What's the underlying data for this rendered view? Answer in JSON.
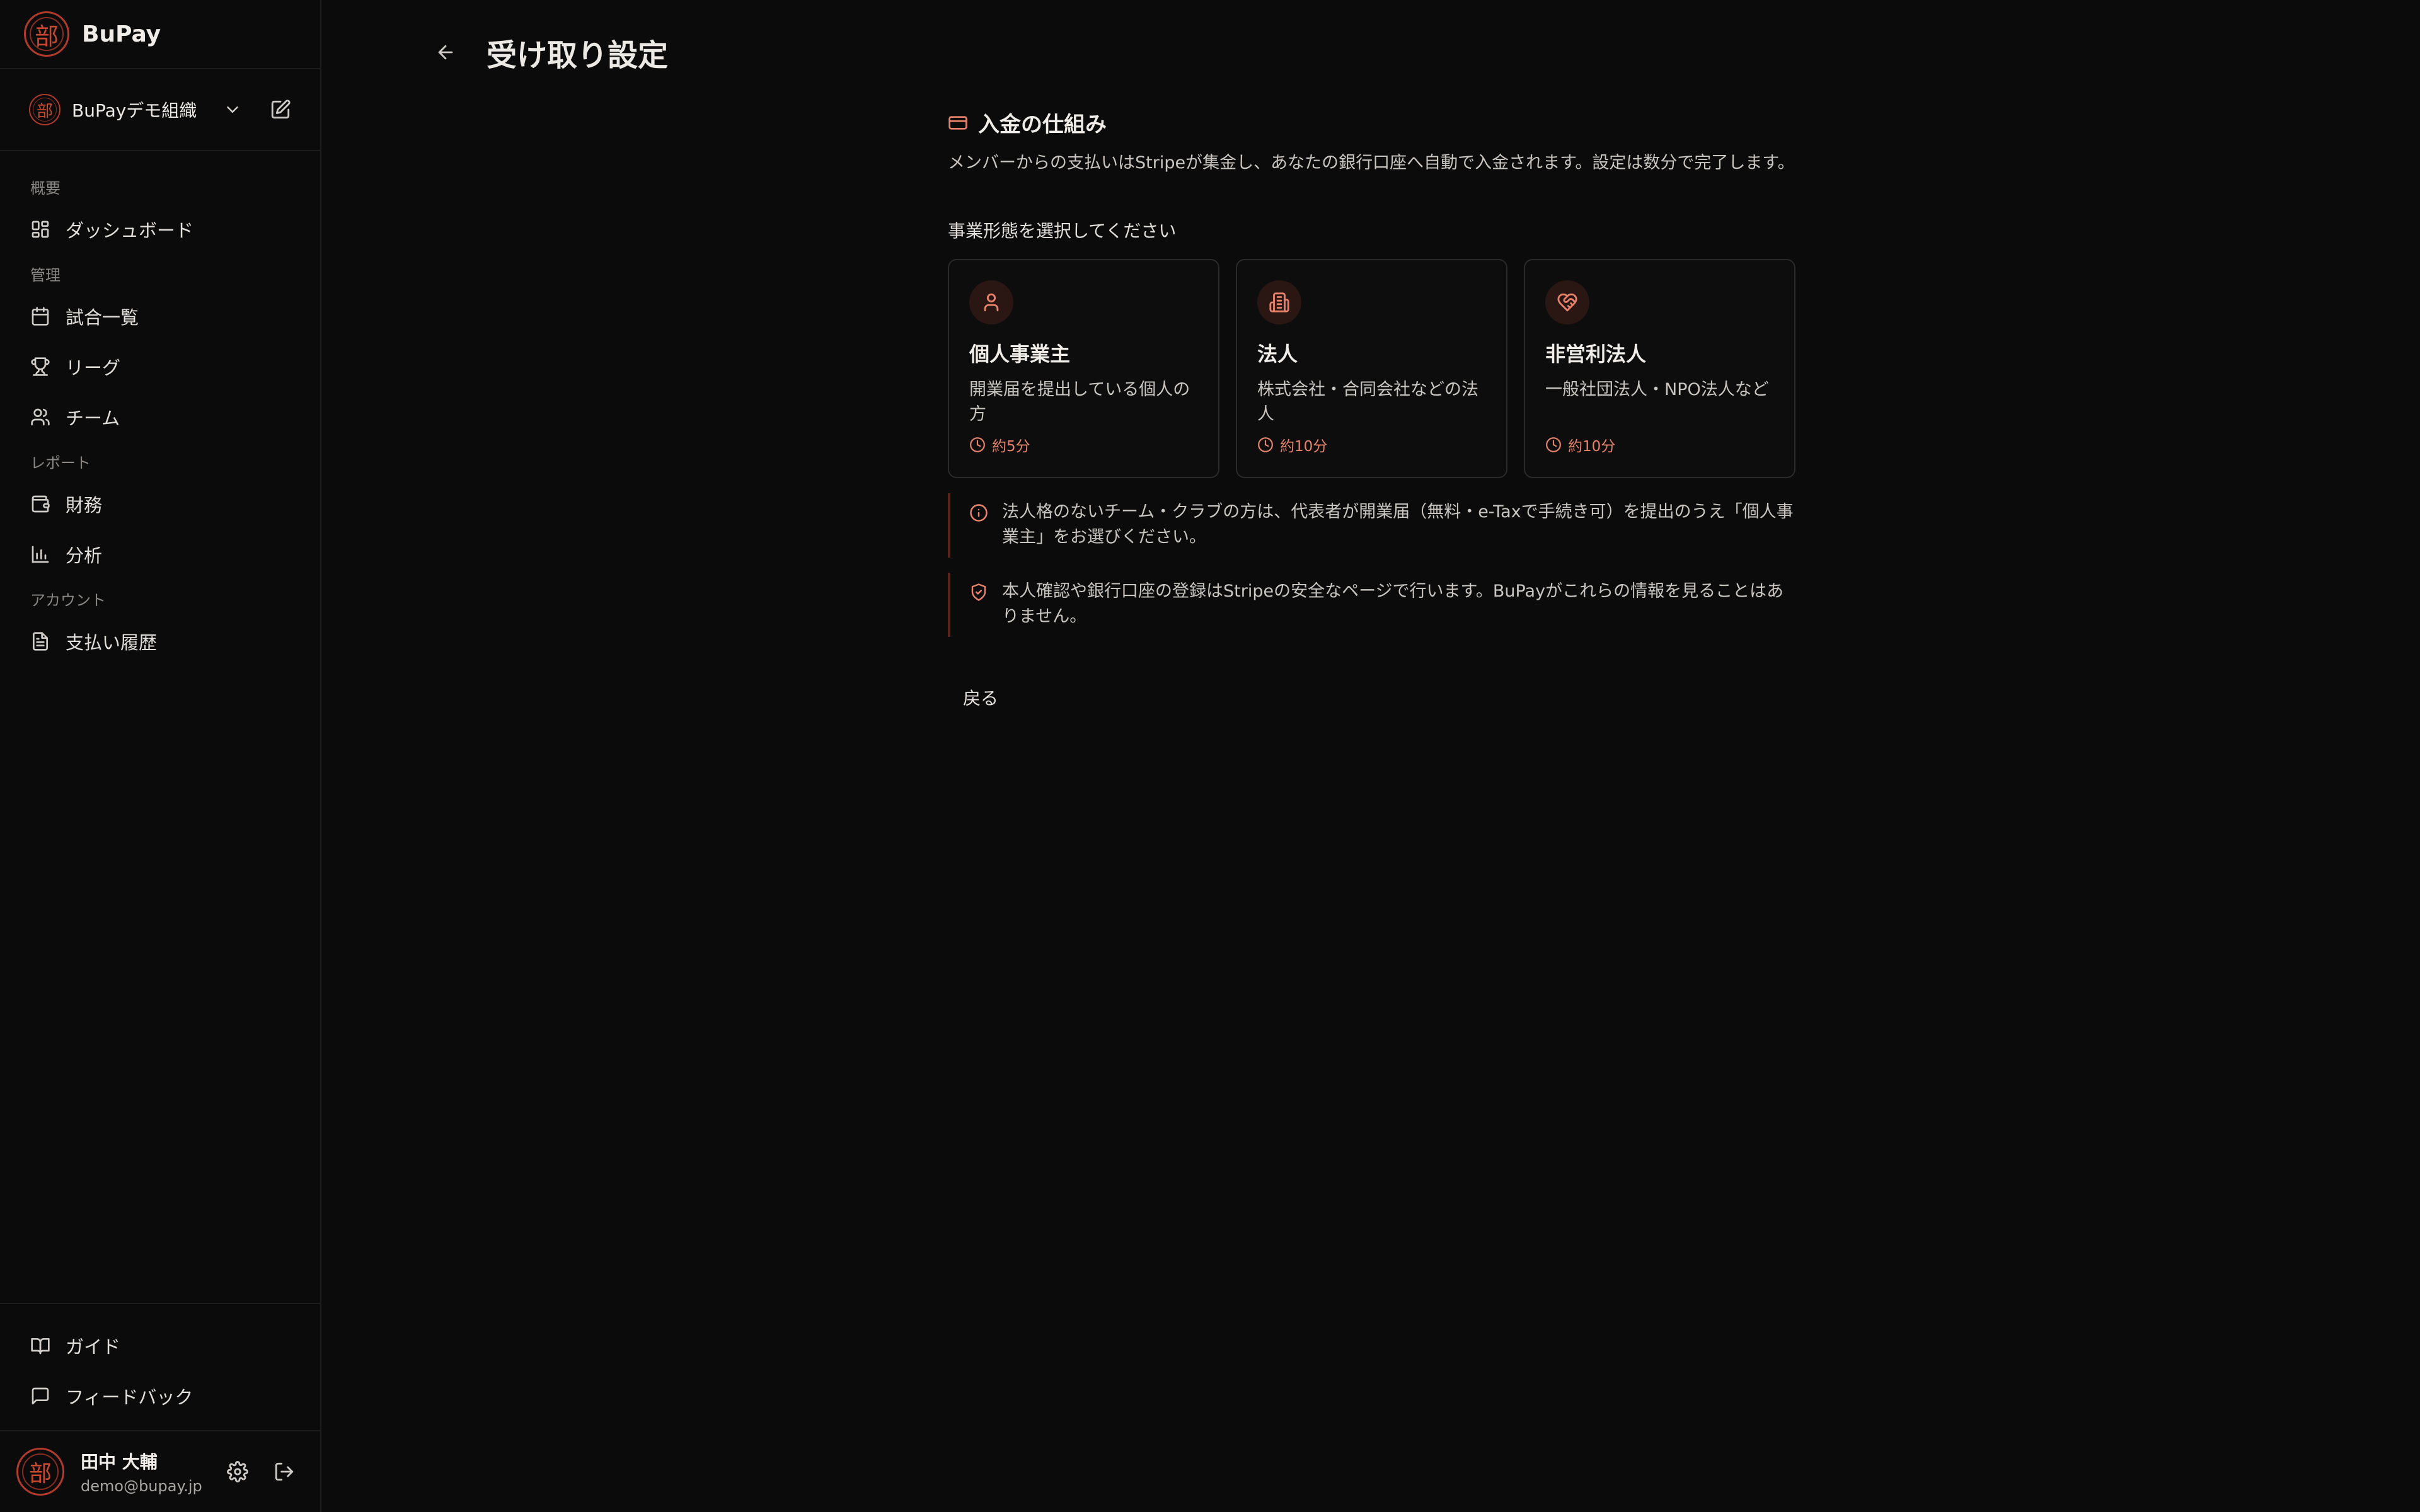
{
  "brand": {
    "logo_char": "部",
    "name": "BuPay"
  },
  "org": {
    "logo_char": "部",
    "name": "BuPayデモ組織"
  },
  "nav": [
    {
      "group": "概要",
      "items": [
        {
          "id": "dashboard",
          "label": "ダッシュボード",
          "icon": "dashboard-icon"
        }
      ]
    },
    {
      "group": "管理",
      "items": [
        {
          "id": "matches",
          "label": "試合一覧",
          "icon": "calendar-icon"
        },
        {
          "id": "league",
          "label": "リーグ",
          "icon": "trophy-icon"
        },
        {
          "id": "team",
          "label": "チーム",
          "icon": "users-icon"
        }
      ]
    },
    {
      "group": "レポート",
      "items": [
        {
          "id": "finance",
          "label": "財務",
          "icon": "wallet-icon"
        },
        {
          "id": "analytics",
          "label": "分析",
          "icon": "bar-chart-icon"
        }
      ]
    },
    {
      "group": "アカウント",
      "items": [
        {
          "id": "payments",
          "label": "支払い履歴",
          "icon": "document-icon"
        }
      ]
    }
  ],
  "bottom_nav": [
    {
      "id": "guide",
      "label": "ガイド",
      "icon": "book-icon"
    },
    {
      "id": "feedback",
      "label": "フィードバック",
      "icon": "message-icon"
    }
  ],
  "user": {
    "logo_char": "部",
    "name": "田中 大輔",
    "email": "demo@bupay.jp"
  },
  "page": {
    "title": "受け取り設定"
  },
  "section": {
    "title": "入金の仕組み",
    "description": "メンバーからの支払いはStripeが集金し、あなたの銀行口座へ自動で入金されます。設定は数分で完了します。",
    "select_label": "事業形態を選択してください"
  },
  "cards": [
    {
      "id": "sole",
      "title": "個人事業主",
      "description": "開業届を提出している個人の方",
      "time": "約5分",
      "icon": "user-icon"
    },
    {
      "id": "corp",
      "title": "法人",
      "description": "株式会社・合同会社などの法人",
      "time": "約10分",
      "icon": "building-icon"
    },
    {
      "id": "npo",
      "title": "非営利法人",
      "description": "一般社団法人・NPO法人など",
      "time": "約10分",
      "icon": "heart-handshake-icon"
    }
  ],
  "notices": [
    {
      "text": "法人格のないチーム・クラブの方は、代表者が開業届（無料・e-Taxで手続き可）を提出のうえ「個人事業主」をお選びください。",
      "icon": "info-icon"
    },
    {
      "text": "本人確認や銀行口座の登録はStripeの安全なページで行います。BuPayがこれらの情報を見ることはありません。",
      "icon": "shield-check-icon"
    }
  ],
  "actions": {
    "back_label": "戻る"
  },
  "colors": {
    "accent": "#e8836b",
    "brand_red": "#c8482f",
    "background": "#0b0b0b"
  }
}
